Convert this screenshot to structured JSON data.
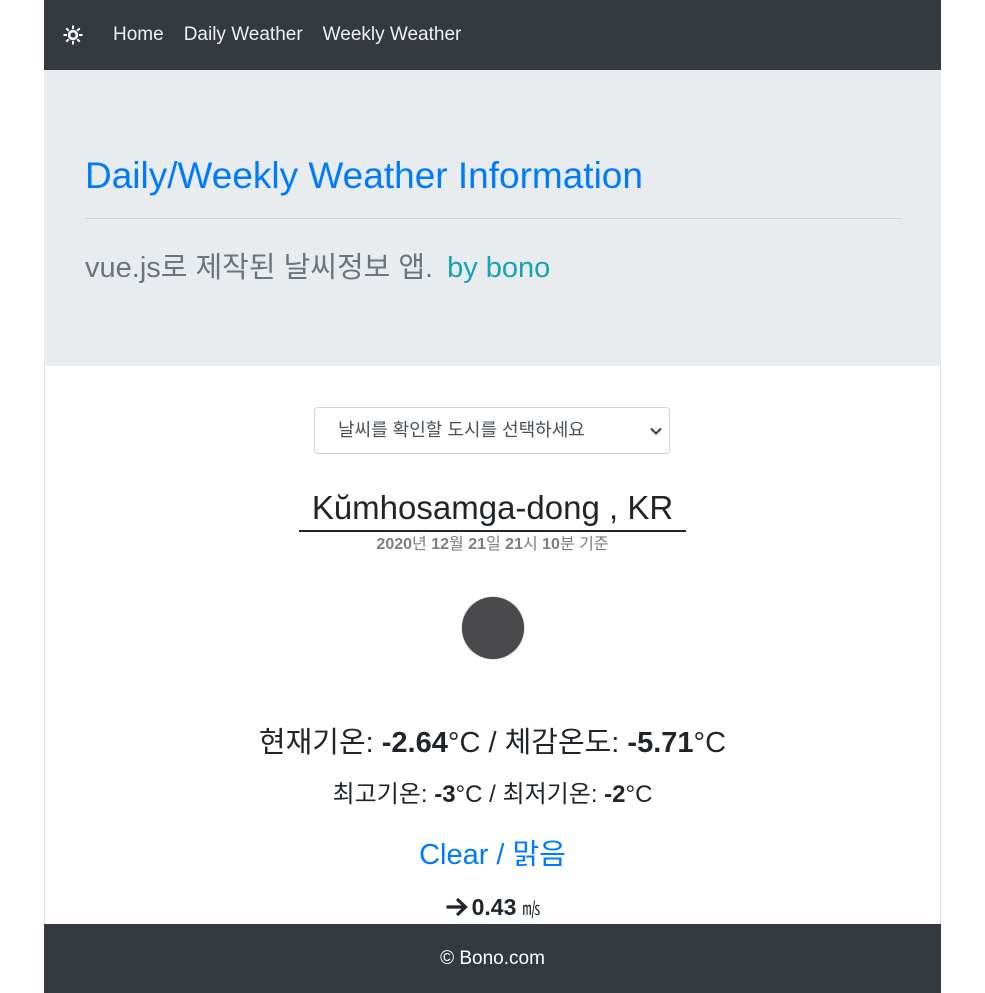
{
  "navbar": {
    "brand_icon": "sun-gear-icon",
    "links": [
      "Home",
      "Daily Weather",
      "Weekly Weather"
    ]
  },
  "jumbotron": {
    "title": "Daily/Weekly Weather Information",
    "lead": "vue.js로 제작된 날씨정보 앱.",
    "by": "by bono"
  },
  "city_select": {
    "selected": "날씨를 확인할 도시를 선택하세요"
  },
  "weather": {
    "city": "Kŭmhosamga-dong , KR",
    "time": {
      "year": "2020",
      "year_unit": "년",
      "month": "12",
      "month_unit": "월",
      "day": "21",
      "day_unit": "일",
      "hour": "21",
      "hour_unit": "시",
      "minute": "10",
      "minute_unit": "분 기준"
    },
    "icon": "night-clear-icon",
    "current_label": "현재기온: ",
    "current_temp": "-2.64",
    "feels_label": "체감온도: ",
    "feels_temp": "-5.71",
    "temp_unit": "°C",
    "separator": " / ",
    "max_label": "최고기온: ",
    "max_temp": "-3",
    "min_label": "최저기온: ",
    "min_temp": "-2",
    "description": "Clear / 맑음",
    "wind_speed": "0.43",
    "wind_unit": "㎧",
    "wind_icon": "arrow-right-icon"
  },
  "footer": {
    "text": "© Bono.com"
  },
  "colors": {
    "navbar": "#343a40",
    "jumbotron": "#e9ecef",
    "primary": "#007bff",
    "info": "#17a2b8",
    "muted": "#6c757d"
  }
}
